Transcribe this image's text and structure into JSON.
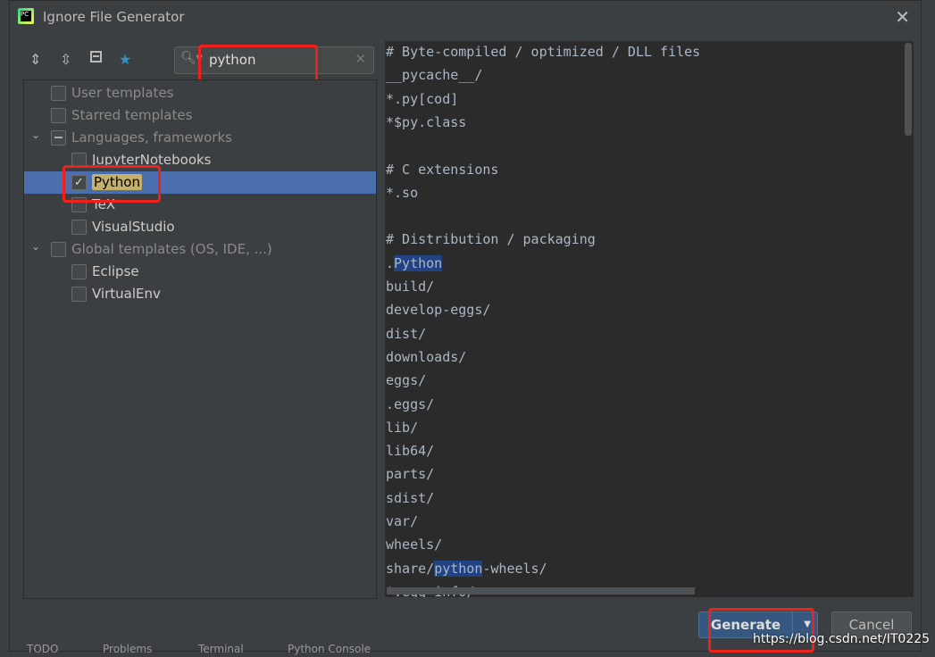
{
  "window": {
    "title": "Ignore File Generator",
    "logo": "PC"
  },
  "toolbar": {
    "icons": [
      "expand-all-icon",
      "collapse-all-icon",
      "select-none-icon",
      "star-icon"
    ],
    "accent": "#3592c4"
  },
  "search": {
    "value": "python"
  },
  "tree": [
    {
      "label": "User templates",
      "level": 0,
      "checked": false,
      "dim": true
    },
    {
      "label": "Starred templates",
      "level": 0,
      "checked": false,
      "dim": true
    },
    {
      "label": "Languages, frameworks",
      "level": 0,
      "checked": "partial",
      "dim": true,
      "expanded": true
    },
    {
      "label": "JupyterNotebooks",
      "level": 1,
      "checked": false
    },
    {
      "label": "Python",
      "level": 1,
      "checked": true,
      "selected": true
    },
    {
      "label": "TeX",
      "level": 1,
      "checked": false
    },
    {
      "label": "VisualStudio",
      "level": 1,
      "checked": false
    },
    {
      "label": "Global templates (OS, IDE, ...)",
      "level": 0,
      "checked": false,
      "dim": true,
      "expanded": true
    },
    {
      "label": "Eclipse",
      "level": 1,
      "checked": false
    },
    {
      "label": "VirtualEnv",
      "level": 1,
      "checked": false
    }
  ],
  "preview": {
    "lines": [
      "# Byte-compiled / optimized / DLL files",
      "__pycache__/",
      "*.py[cod]",
      "*$py.class",
      "",
      "# C extensions",
      "*.so",
      "",
      "# Distribution / packaging",
      ".Python",
      "build/",
      "develop-eggs/",
      "dist/",
      "downloads/",
      "eggs/",
      ".eggs/",
      "lib/",
      "lib64/",
      "parts/",
      "sdist/",
      "var/",
      "wheels/",
      "share/python-wheels/",
      "*.egg-info/"
    ]
  },
  "buttons": {
    "generate": "Generate",
    "cancel": "Cancel"
  },
  "watermark": "https://blog.csdn.net/IT0225",
  "ide_bottom": [
    "TODO",
    "Problems",
    "Terminal",
    "Python Console"
  ]
}
